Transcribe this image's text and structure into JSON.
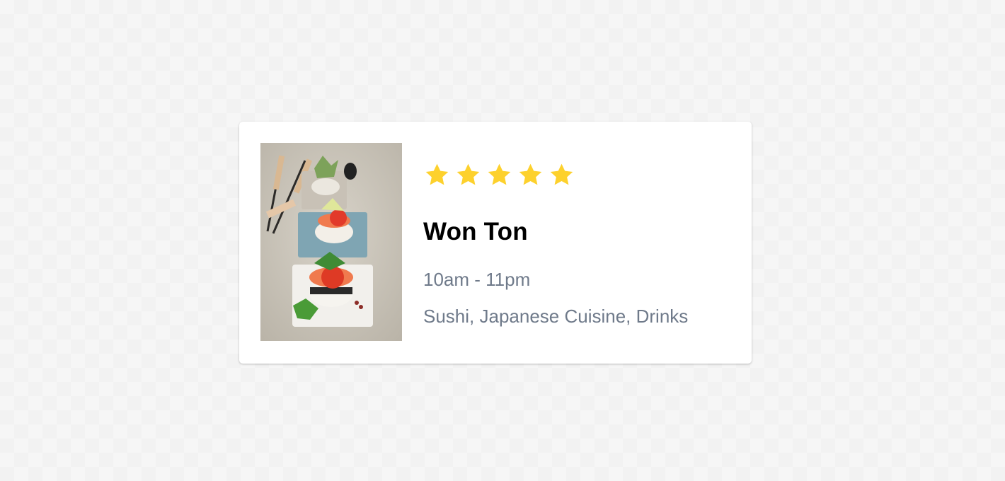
{
  "restaurant": {
    "photo_alt": "",
    "rating": 5,
    "rating_max": 5,
    "star_color": "#fdd12d",
    "name": "Won Ton",
    "hours": "10am - 11pm",
    "categories": "Sushi, Japanese Cuisine, Drinks"
  },
  "colors": {
    "muted_text": "#6f7a8a",
    "title_text": "#000000",
    "card_background": "#ffffff"
  }
}
